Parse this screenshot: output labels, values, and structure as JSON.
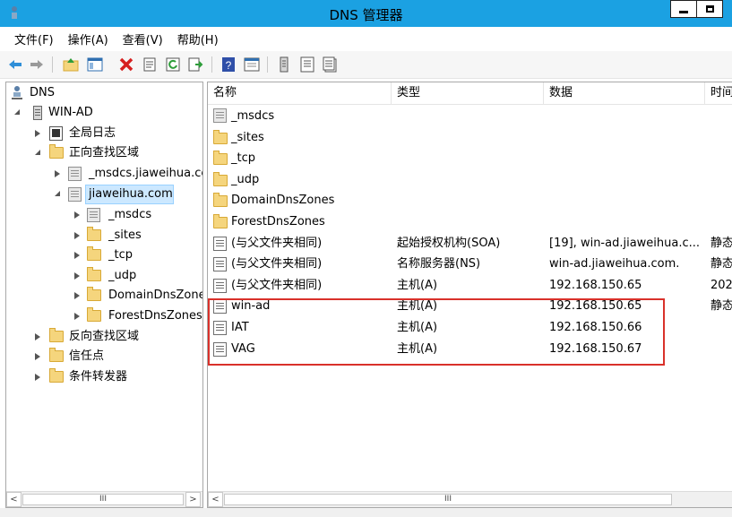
{
  "window": {
    "title": "DNS 管理器",
    "accent_color": "#1ba1e2"
  },
  "menu": [
    "文件(F)",
    "操作(A)",
    "查看(V)",
    "帮助(H)"
  ],
  "toolbar_icons": [
    "back-arrow-icon",
    "forward-arrow-icon",
    "up-folder-icon",
    "show-hide-tree-icon",
    "delete-icon",
    "properties-icon",
    "refresh-icon",
    "export-list-icon",
    "help-icon",
    "mmc-view-icon",
    "server-icon",
    "zone-icon",
    "record-icon"
  ],
  "tree": {
    "root": "DNS",
    "server": "WIN-AD",
    "global_log": "全局日志",
    "forward_zones": "正向查找区域",
    "msdcs_zone": "_msdcs.jiaweihua.cc",
    "selected_zone": "jiaweihua.com",
    "children": [
      "_msdcs",
      "_sites",
      "_tcp",
      "_udp",
      "DomainDnsZones",
      "ForestDnsZones"
    ],
    "reverse_zones": "反向查找区域",
    "trust_points": "信任点",
    "conditional_forwarders": "条件转发器"
  },
  "list": {
    "columns": [
      "名称",
      "类型",
      "数据",
      "时间"
    ],
    "rows": [
      {
        "name": "_msdcs",
        "type": "",
        "data": "",
        "time": "",
        "icon": "zone"
      },
      {
        "name": "_sites",
        "type": "",
        "data": "",
        "time": "",
        "icon": "folder"
      },
      {
        "name": "_tcp",
        "type": "",
        "data": "",
        "time": "",
        "icon": "folder"
      },
      {
        "name": "_udp",
        "type": "",
        "data": "",
        "time": "",
        "icon": "folder"
      },
      {
        "name": "DomainDnsZones",
        "type": "",
        "data": "",
        "time": "",
        "icon": "folder"
      },
      {
        "name": "ForestDnsZones",
        "type": "",
        "data": "",
        "time": "",
        "icon": "folder"
      },
      {
        "name": "(与父文件夹相同)",
        "type": "起始授权机构(SOA)",
        "data": "[19], win-ad.jiaweihua.c...",
        "time": "静态",
        "icon": "record"
      },
      {
        "name": "(与父文件夹相同)",
        "type": "名称服务器(NS)",
        "data": "win-ad.jiaweihua.com.",
        "time": "静态",
        "icon": "record"
      },
      {
        "name": "(与父文件夹相同)",
        "type": "主机(A)",
        "data": "192.168.150.65",
        "time": "202",
        "icon": "record"
      },
      {
        "name": "win-ad",
        "type": "主机(A)",
        "data": "192.168.150.65",
        "time": "静态",
        "icon": "record"
      },
      {
        "name": "IAT",
        "type": "主机(A)",
        "data": "192.168.150.66",
        "time": "",
        "icon": "record"
      },
      {
        "name": "VAG",
        "type": "主机(A)",
        "data": "192.168.150.67",
        "time": "",
        "icon": "record"
      }
    ]
  },
  "scroll": {
    "thumb_glyph": "III",
    "left_glyph": "<",
    "right_glyph": ">"
  },
  "highlight_color": "#d9312a"
}
